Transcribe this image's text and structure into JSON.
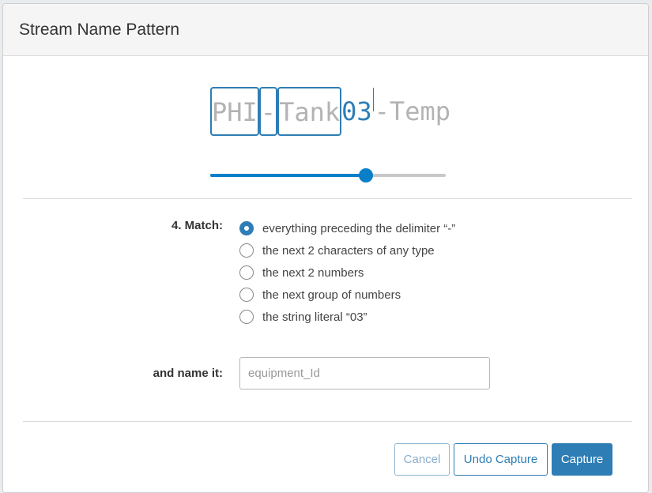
{
  "dialog": {
    "title": "Stream Name Pattern"
  },
  "pattern": {
    "segments": [
      "PHI",
      "-",
      "Tank",
      "03",
      "-Temp"
    ]
  },
  "slider": {
    "value_fraction": 0.66
  },
  "match": {
    "label": "4. Match:",
    "options": [
      "everything preceding the delimiter “-”",
      "the next 2 characters of any type",
      "the next 2 numbers",
      "the next group of numbers",
      "the string literal “03”"
    ],
    "selected_index": 0
  },
  "name": {
    "label": "and name it:",
    "placeholder": "equipment_Id"
  },
  "buttons": {
    "cancel": "Cancel",
    "undo_capture": "Undo Capture",
    "capture": "Capture"
  },
  "colors": {
    "accent": "#2e7db5",
    "slider": "#0a7fc9"
  }
}
